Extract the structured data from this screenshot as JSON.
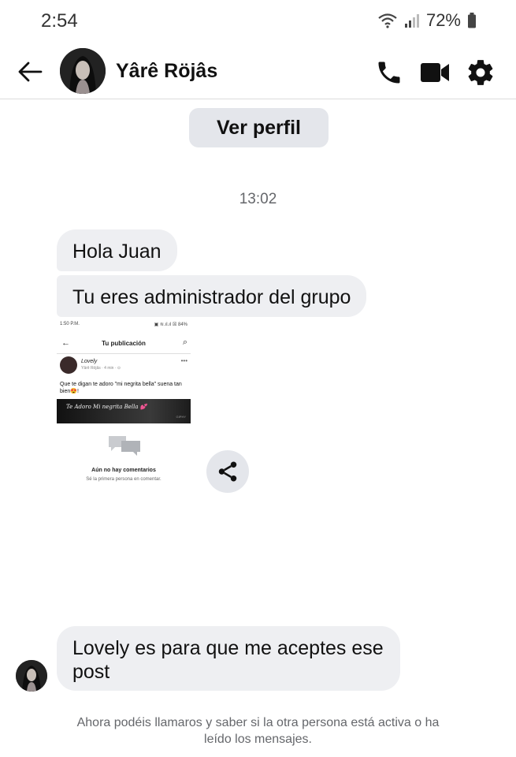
{
  "status_bar": {
    "time": "2:54",
    "battery": "72%"
  },
  "header": {
    "contact_name": "Yârê Röjâs",
    "icons": [
      "back-arrow-icon",
      "phone-icon",
      "video-camera-icon",
      "gear-icon"
    ]
  },
  "profile_button": {
    "label": "Ver perfil"
  },
  "conversation": {
    "timestamp": "13:02",
    "messages": [
      {
        "text": "Hola Juan"
      },
      {
        "text": "Tu eres administrador del grupo"
      },
      {
        "text": "Lovely es para que me aceptes ese post"
      }
    ],
    "shared_screenshot": {
      "status_time": "1:50 P.M.",
      "status_right": "▣ ≋.ıl.ıl ☒ 84%",
      "title": "Tu publicación",
      "post_author": "Lovely",
      "post_meta": "Yârê Röjâs · 4 min · ⊙",
      "post_text": "Que te digan te adoro \"mi negrita bella\" suena tan bien😍!",
      "banner_text": "Te Adoro Mi negrita Bella 💕",
      "banner_mark": "GIPHY",
      "no_comments": "Aún no hay comentarios",
      "first_comment": "Sé la primera persona en comentar."
    }
  },
  "footer": {
    "note": "Ahora podéis llamaros y saber si la otra persona está activa o ha leído los mensajes."
  },
  "colors": {
    "bubble_bg": "#eeeff2",
    "button_bg": "#e4e6eb",
    "secondary_text": "#65676b"
  }
}
